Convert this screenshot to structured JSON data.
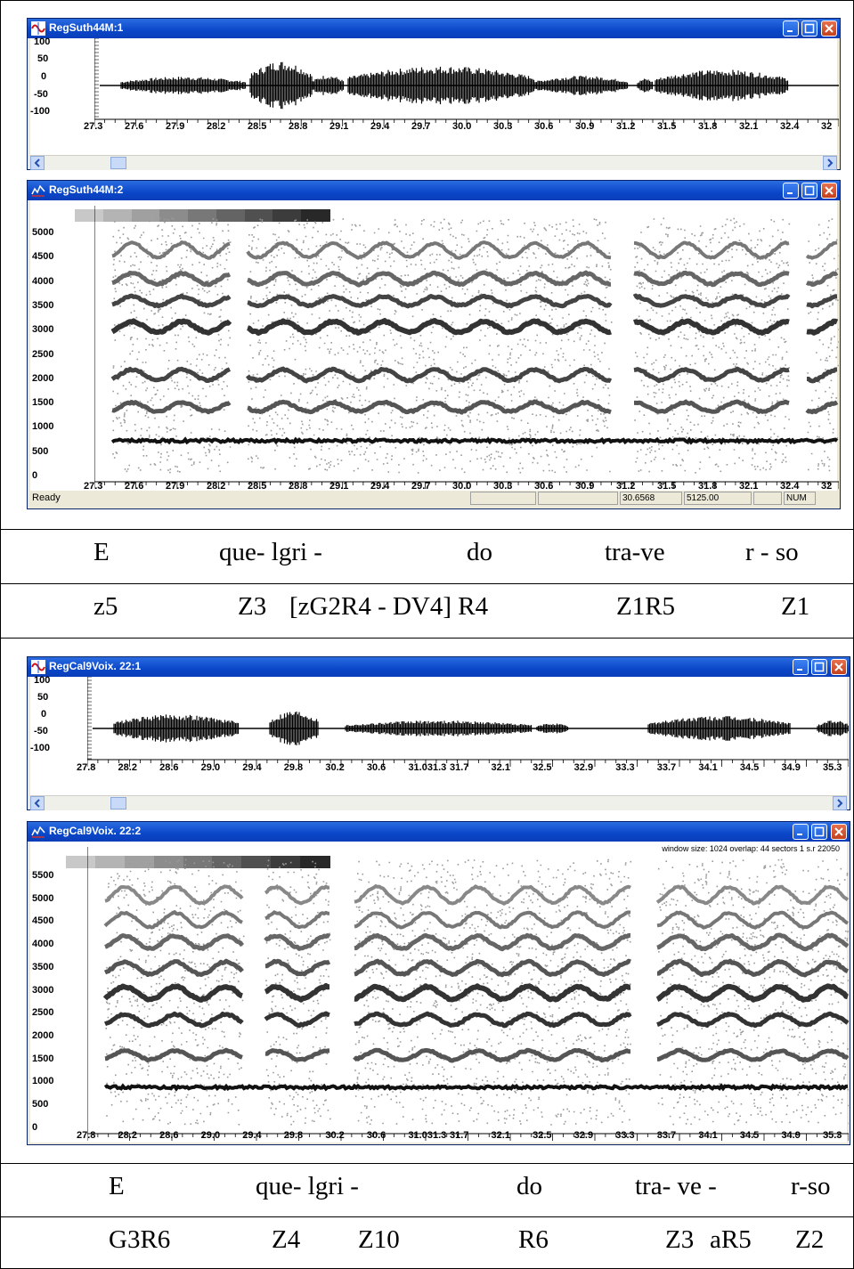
{
  "top": {
    "wave_title": "RegSuth44M:1",
    "spec_title": "RegSuth44M:2",
    "wave_yticks": [
      "100",
      "50",
      "0",
      "-50",
      "-100"
    ],
    "spec_yticks": [
      "5000",
      "4500",
      "4000",
      "3500",
      "3000",
      "2500",
      "2000",
      "1500",
      "1000",
      "500",
      "0"
    ],
    "xticks": [
      "27.3",
      "27.6",
      "27.9",
      "28.2",
      "28.5",
      "28.8",
      "29.1",
      "29.4",
      "29.7",
      "30.0",
      "30.3",
      "30.6",
      "30.9",
      "31.2",
      "31.5",
      "31.8",
      "32.1",
      "32.4",
      "32"
    ],
    "status": {
      "ready": "Ready",
      "coord_x": "30.6568",
      "coord_y": "5125.00",
      "num": "NUM"
    },
    "lyrics": [
      "E",
      "que- lgri -",
      "do",
      "tra-ve",
      "r - so"
    ],
    "codes": [
      "z5",
      "Z3",
      "[zG2R4 - DV4] R4",
      "Z1R5",
      "Z1"
    ]
  },
  "bottom": {
    "wave_title": "RegCal9Voix. 22:1",
    "spec_title": "RegCal9Voix. 22:2",
    "window_info": "window size: 1024 overlap: 44 sectors 1 s.r 22050",
    "wave_yticks": [
      "100",
      "50",
      "0",
      "-50",
      "-100"
    ],
    "spec_yticks": [
      "5500",
      "5000",
      "4500",
      "4000",
      "3500",
      "3000",
      "2500",
      "2000",
      "1500",
      "1000",
      "500",
      "0"
    ],
    "xticks": [
      "27.8",
      "28.2",
      "28.6",
      "29.0",
      "29.4",
      "29.8",
      "30.2",
      "30.6",
      "31.031.3",
      "31.7",
      "32.1",
      "32.5",
      "32.9",
      "33.3",
      "33.7",
      "34.1",
      "34.5",
      "34.9",
      "35.3"
    ],
    "lyrics": [
      "E",
      "que- lgri -",
      "do",
      "tra- ve -",
      "r-so"
    ],
    "codes": [
      "G3R6",
      "Z4",
      "Z10",
      "R6",
      "Z3",
      "aR5",
      "Z2"
    ]
  },
  "colors": {
    "titlebar": "#0a47c9",
    "close": "#c4401c"
  }
}
